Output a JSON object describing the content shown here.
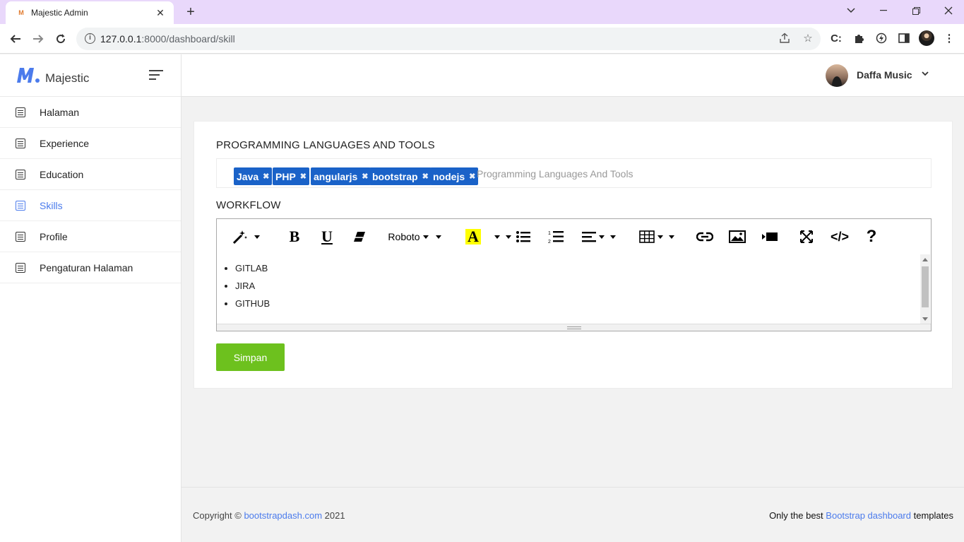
{
  "browser": {
    "tab_title": "Majestic Admin",
    "url_host": "127.0.0.1",
    "url_rest": ":8000/dashboard/skill"
  },
  "app": {
    "brand": "Majestic",
    "user_name": "Daffa Music"
  },
  "sidebar": {
    "items": [
      {
        "label": "Halaman"
      },
      {
        "label": "Experience"
      },
      {
        "label": "Education"
      },
      {
        "label": "Skills"
      },
      {
        "label": "Profile"
      },
      {
        "label": "Pengaturan Halaman"
      }
    ],
    "active_index": 3
  },
  "form": {
    "languages_label": "PROGRAMMING LANGUAGES AND TOOLS",
    "tags": [
      "Java",
      "PHP",
      "angularjs",
      "bootstrap",
      "nodejs"
    ],
    "tags_placeholder": "Programming Languages And Tools",
    "workflow_label": "WORKFLOW",
    "toolbar": {
      "font_name": "Roboto",
      "bold": "B",
      "underline": "U",
      "highlight": "A",
      "help": "?",
      "code": "</>"
    },
    "workflow_items": [
      "GITLAB",
      "JIRA",
      "GITHUB"
    ],
    "save_label": "Simpan"
  },
  "footer": {
    "copyright_prefix": "Copyright ©",
    "copyright_link": "bootstrapdash.com",
    "copyright_year": "2021",
    "right_prefix": "Only the best",
    "right_link": "Bootstrap dashboard",
    "right_suffix": "templates"
  },
  "colors": {
    "accent": "#4b7bec",
    "tag": "#1a62c8",
    "save": "#6dc11e",
    "tabbar": "#e9d8fb"
  }
}
